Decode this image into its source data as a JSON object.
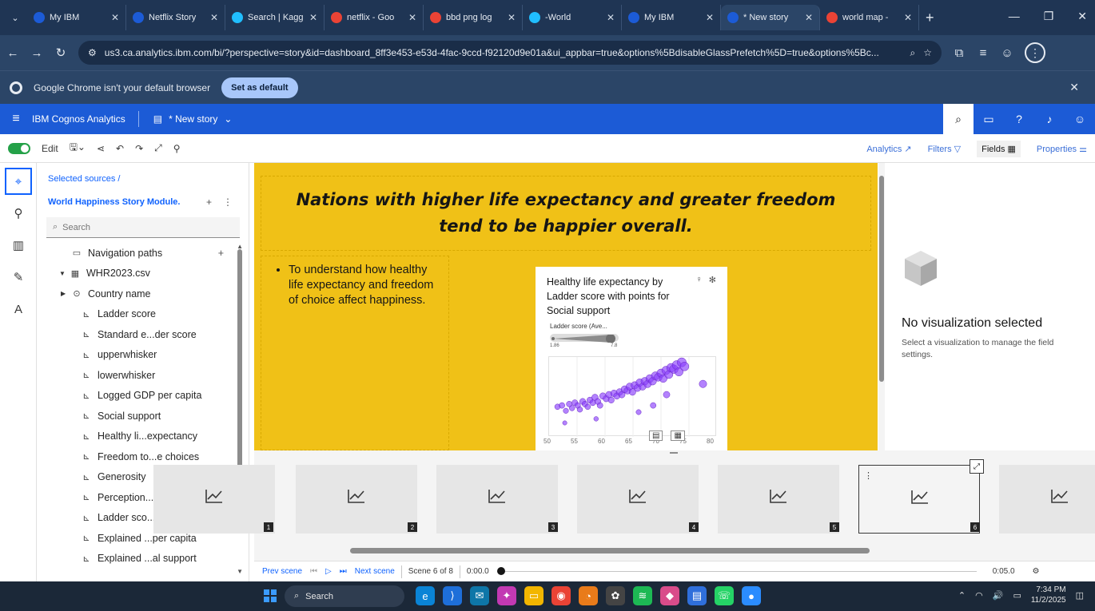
{
  "browser": {
    "tabs": [
      {
        "title": "My IBM",
        "color": "#1c5bd6"
      },
      {
        "title": "Netflix Story",
        "color": "#1c5bd6"
      },
      {
        "title": "Search | Kagg",
        "color": "#20beff"
      },
      {
        "title": "netflix - Goo",
        "color": "#ea4335"
      },
      {
        "title": "bbd png log",
        "color": "#ea4335"
      },
      {
        "title": "-World",
        "color": "#20beff"
      },
      {
        "title": "My IBM",
        "color": "#1c5bd6"
      },
      {
        "title": "* New story",
        "color": "#1c5bd6"
      },
      {
        "title": "world map -",
        "color": "#ea4335"
      }
    ],
    "url": "us3.ca.analytics.ibm.com/bi/?perspective=story&id=dashboard_8ff3e453-e53d-4fac-9ccd-f92120d9e01a&ui_appbar=true&options%5BdisableGlassPrefetch%5D=true&options%5Bc...",
    "infobar_text": "Google Chrome isn't your default browser",
    "set_default_label": "Set as default"
  },
  "app": {
    "brand": "IBM Cognos Analytics",
    "story_title": "* New story"
  },
  "toolbar": {
    "edit_label": "Edit",
    "analytics_label": "Analytics",
    "filters_label": "Filters",
    "fields_label": "Fields",
    "properties_label": "Properties"
  },
  "sources": {
    "selected_label": "Selected sources /",
    "module_name": "World Happiness Story Module.",
    "search_placeholder": "Search",
    "tree": [
      {
        "label": "Navigation paths",
        "level": 1,
        "icon": "folder-icon",
        "glyph": "▭",
        "plus": true
      },
      {
        "label": "WHR2023.csv",
        "level": 0,
        "icon": "table-icon",
        "glyph": "▦",
        "caret": "▼"
      },
      {
        "label": "Country name",
        "level": 1,
        "icon": "location-icon",
        "glyph": "⊙",
        "caret": "▶"
      },
      {
        "label": "Ladder score",
        "level": 2,
        "icon": "measure-icon",
        "glyph": "⊾"
      },
      {
        "label": "Standard e...der score",
        "level": 2,
        "icon": "measure-icon",
        "glyph": "⊾"
      },
      {
        "label": "upperwhisker",
        "level": 2,
        "icon": "measure-icon",
        "glyph": "⊾"
      },
      {
        "label": "lowerwhisker",
        "level": 2,
        "icon": "measure-icon",
        "glyph": "⊾"
      },
      {
        "label": "Logged GDP per capita",
        "level": 2,
        "icon": "measure-icon",
        "glyph": "⊾"
      },
      {
        "label": "Social support",
        "level": 2,
        "icon": "measure-icon",
        "glyph": "⊾"
      },
      {
        "label": "Healthy li...expectancy",
        "level": 2,
        "icon": "measure-icon",
        "glyph": "⊾"
      },
      {
        "label": "Freedom to...e choices",
        "level": 2,
        "icon": "measure-icon",
        "glyph": "⊾"
      },
      {
        "label": "Generosity",
        "level": 2,
        "icon": "measure-icon",
        "glyph": "⊾"
      },
      {
        "label": "Perception...orruption",
        "level": 2,
        "icon": "measure-icon",
        "glyph": "⊾"
      },
      {
        "label": "Ladder sco... Dystopia",
        "level": 2,
        "icon": "measure-icon",
        "glyph": "⊾"
      },
      {
        "label": "Explained ...per capita",
        "level": 2,
        "icon": "measure-icon",
        "glyph": "⊾"
      },
      {
        "label": "Explained ...al support",
        "level": 2,
        "icon": "measure-icon",
        "glyph": "⊾"
      }
    ]
  },
  "canvas": {
    "headline": "Nations with higher life expectancy and greater freedom tend to be happier overall.",
    "bullet": "To understand how healthy life expectancy and freedom of choice affect happiness.",
    "background_color": "#f0c117"
  },
  "viz": {
    "title": "Healthy life expectancy by Ladder score with points for Social support",
    "legend_title": "Ladder score (Ave...",
    "legend_min": "1.86",
    "legend_max": "7.8",
    "x_ticks": [
      "50",
      "55",
      "60",
      "65",
      "70",
      "75",
      "80"
    ],
    "point_color": "#8a3ffc"
  },
  "chart_data": {
    "type": "scatter",
    "title": "Healthy life expectancy by Ladder score with points for Social support",
    "xlim": [
      50,
      80
    ],
    "ylim": [
      1.86,
      7.8
    ],
    "legend": "Ladder score (Ave...",
    "points": [
      {
        "x": 51.5,
        "y": 4.1
      },
      {
        "x": 52.3,
        "y": 4.2
      },
      {
        "x": 53,
        "y": 3.8
      },
      {
        "x": 53.6,
        "y": 4.3
      },
      {
        "x": 54.1,
        "y": 4.0
      },
      {
        "x": 54.6,
        "y": 4.4
      },
      {
        "x": 55.1,
        "y": 4.2
      },
      {
        "x": 55.5,
        "y": 3.9
      },
      {
        "x": 56,
        "y": 4.5
      },
      {
        "x": 56.4,
        "y": 4.3
      },
      {
        "x": 56.9,
        "y": 4.1
      },
      {
        "x": 57.3,
        "y": 4.6
      },
      {
        "x": 57.8,
        "y": 4.4
      },
      {
        "x": 58.2,
        "y": 4.8
      },
      {
        "x": 58.7,
        "y": 4.5
      },
      {
        "x": 59.1,
        "y": 4.2
      },
      {
        "x": 59.6,
        "y": 4.9
      },
      {
        "x": 60.2,
        "y": 4.7
      },
      {
        "x": 60.7,
        "y": 5.0
      },
      {
        "x": 61.1,
        "y": 4.6
      },
      {
        "x": 61.6,
        "y": 5.1
      },
      {
        "x": 62.1,
        "y": 4.9
      },
      {
        "x": 62.6,
        "y": 5.2
      },
      {
        "x": 63.0,
        "y": 5.0
      },
      {
        "x": 63.5,
        "y": 5.4
      },
      {
        "x": 64.0,
        "y": 5.3
      },
      {
        "x": 64.4,
        "y": 5.6
      },
      {
        "x": 64.9,
        "y": 5.2
      },
      {
        "x": 65.3,
        "y": 5.7
      },
      {
        "x": 65.8,
        "y": 5.5
      },
      {
        "x": 66.2,
        "y": 5.9
      },
      {
        "x": 66.7,
        "y": 5.6
      },
      {
        "x": 67.1,
        "y": 6.0
      },
      {
        "x": 67.6,
        "y": 5.8
      },
      {
        "x": 68.0,
        "y": 6.2
      },
      {
        "x": 68.5,
        "y": 6.0
      },
      {
        "x": 69.0,
        "y": 6.4
      },
      {
        "x": 69.5,
        "y": 6.3
      },
      {
        "x": 70.0,
        "y": 6.6
      },
      {
        "x": 70.4,
        "y": 6.2
      },
      {
        "x": 70.9,
        "y": 6.8
      },
      {
        "x": 71.4,
        "y": 6.5
      },
      {
        "x": 71.8,
        "y": 7.0
      },
      {
        "x": 72.3,
        "y": 6.9
      },
      {
        "x": 72.8,
        "y": 7.2
      },
      {
        "x": 73.2,
        "y": 6.7
      },
      {
        "x": 73.7,
        "y": 7.4
      },
      {
        "x": 74.2,
        "y": 7.1
      },
      {
        "x": 58.4,
        "y": 3.2
      },
      {
        "x": 66.0,
        "y": 3.7
      },
      {
        "x": 52.8,
        "y": 2.9
      },
      {
        "x": 77.5,
        "y": 5.8
      },
      {
        "x": 68.6,
        "y": 4.2
      },
      {
        "x": 71.0,
        "y": 5.0
      }
    ]
  },
  "props": {
    "no_viz_title": "No visualization selected",
    "no_viz_sub": "Select a visualization to manage the field settings."
  },
  "scenes": [
    {
      "num": "1"
    },
    {
      "num": "2"
    },
    {
      "num": "3"
    },
    {
      "num": "4"
    },
    {
      "num": "5"
    },
    {
      "num": "6"
    },
    {
      "num": ""
    }
  ],
  "playback": {
    "prev_label": "Prev scene",
    "next_label": "Next scene",
    "scene_status": "Scene 6 of 8",
    "time_start": "0:00.0",
    "time_end": "0:05.0"
  },
  "taskbar": {
    "search_label": "Search",
    "time": "7:34 PM",
    "date": "11/2/2025"
  }
}
